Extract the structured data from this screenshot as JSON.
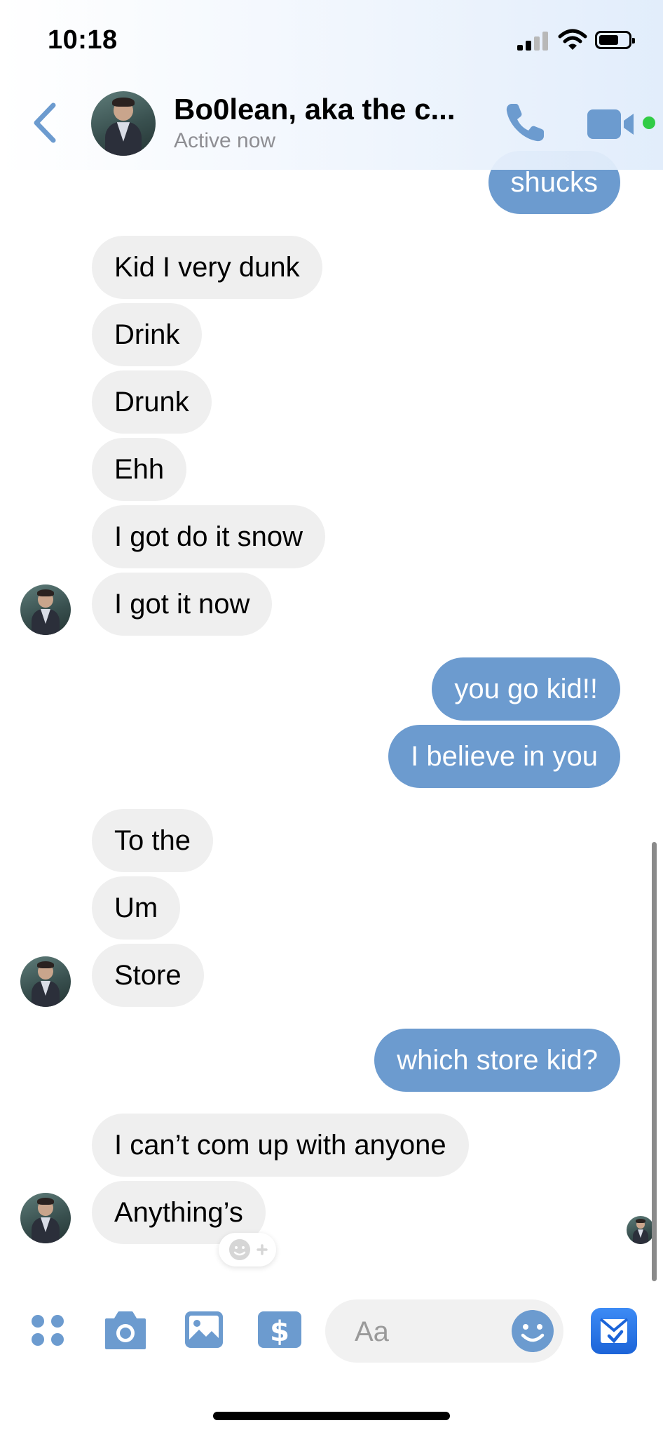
{
  "status_bar": {
    "time": "10:18"
  },
  "header": {
    "contact_name": "Bo0lean, aka the c...",
    "contact_status": "Active now"
  },
  "messages": [
    {
      "text": "shucks",
      "sender": "me"
    },
    {
      "text": "Kid I very dunk",
      "sender": "contact"
    },
    {
      "text": "Drink",
      "sender": "contact"
    },
    {
      "text": "Drunk",
      "sender": "contact"
    },
    {
      "text": "Ehh",
      "sender": "contact"
    },
    {
      "text": "I got do it snow",
      "sender": "contact"
    },
    {
      "text": "I got it now",
      "sender": "contact"
    },
    {
      "text": "you go kid!!",
      "sender": "me"
    },
    {
      "text": "I believe in you",
      "sender": "me"
    },
    {
      "text": "To the",
      "sender": "contact"
    },
    {
      "text": "Um",
      "sender": "contact"
    },
    {
      "text": "Store",
      "sender": "contact"
    },
    {
      "text": "which store kid?",
      "sender": "me"
    },
    {
      "text": "I can’t com up with anyone",
      "sender": "contact"
    },
    {
      "text": "Anything’s",
      "sender": "contact"
    }
  ],
  "composer": {
    "placeholder": "Aa"
  },
  "icons": {
    "back": "chevron-left-icon",
    "call": "phone-icon",
    "video": "video-camera-icon",
    "menu": "four-dots-icon",
    "camera": "camera-icon",
    "gallery": "photo-icon",
    "payment": "dollar-icon",
    "emoji": "smiley-icon",
    "send": "quick-send-icon"
  },
  "colors": {
    "accent": "#6c9bcf",
    "incoming_bubble": "#efefef",
    "online": "#31cc46"
  }
}
